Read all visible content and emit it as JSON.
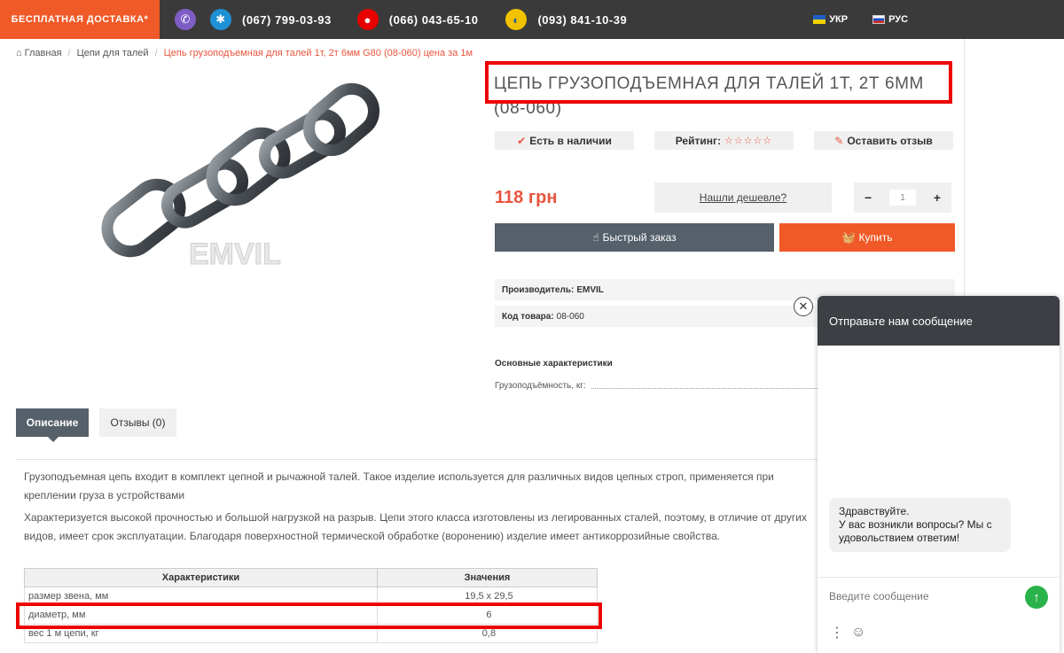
{
  "topbar": {
    "free_shipping": "БЕСПЛАТНАЯ ДОСТАВКА*",
    "phones": [
      {
        "icon": "kyivstar-icon",
        "number": "(067) 799-03-93"
      },
      {
        "icon": "vodafone-icon",
        "number": "(066) 043-65-10"
      },
      {
        "icon": "lifecell-icon",
        "number": "(093) 841-10-39"
      }
    ],
    "languages": [
      "УКР",
      "РУС"
    ],
    "colors": {
      "accent": "#f05a28",
      "bar": "#3a3a3a"
    }
  },
  "breadcrumb": {
    "home": "Главная",
    "category": "Цепи для талей",
    "current": "Цепь грузоподъемная для талей 1т, 2т 6мм G80 (08-060) цена за 1м"
  },
  "product": {
    "title": "ЦЕПЬ ГРУЗОПОДЪЕМНАЯ ДЛЯ ТАЛЕЙ 1Т, 2Т 6ММ (08-060)",
    "watermark": "EMVIL",
    "in_stock": "Есть в наличии",
    "rating_label": "Рейтинг:",
    "rating_stars": "☆☆☆☆☆",
    "leave_review": "Оставить отзыв",
    "price": "118 грн",
    "found_cheaper": "Нашли дешевле?",
    "qty_minus": "−",
    "qty_value": "1",
    "qty_plus": "+",
    "quick_order": "Быстрый заказ",
    "buy": "Купить",
    "manufacturer_label": "Производитель:",
    "manufacturer": "EMVIL",
    "code_label": "Код товара:",
    "code": "08-060",
    "specs_heading": "Основные характеристики",
    "spec_capacity_label": "Грузоподъёмность, кг:"
  },
  "tabs": {
    "description": "Описание",
    "reviews": "Отзывы (0)"
  },
  "description": {
    "p1": "Грузоподъемная цепь входит в комплект цепной и рычажной талей. Такое изделие используется для различных видов цепных строп, применяется при креплении груза в устройствами",
    "p2": "Характеризуется высокой прочностью и большой нагрузкой на разрыв. Цепи этого класса изготовлены из легированных сталей, поэтому, в отличие от других видов, имеет срок эксплуатации. Благодаря поверхностной термической обработке (воронению) изделие имеет антикоррозийные свойства."
  },
  "table": {
    "headers": [
      "Характеристики",
      "Значения"
    ],
    "rows": [
      [
        "размер звена, мм",
        "19,5 х 29,5"
      ],
      [
        "диаметр, мм",
        "6"
      ],
      [
        "вес 1 м цепи, кг",
        "0,8"
      ]
    ]
  },
  "chat": {
    "header": "Отправьте нам сообщение",
    "greeting": "Здравствуйте.\nУ вас возникли вопросы? Мы с удовольствием ответим!",
    "greeting_l1": "Здравствуйте.",
    "greeting_l2": "У вас возникли вопросы? Мы с удовольствием ответим!",
    "input_placeholder": "Введите сообщение",
    "close": "✕"
  }
}
